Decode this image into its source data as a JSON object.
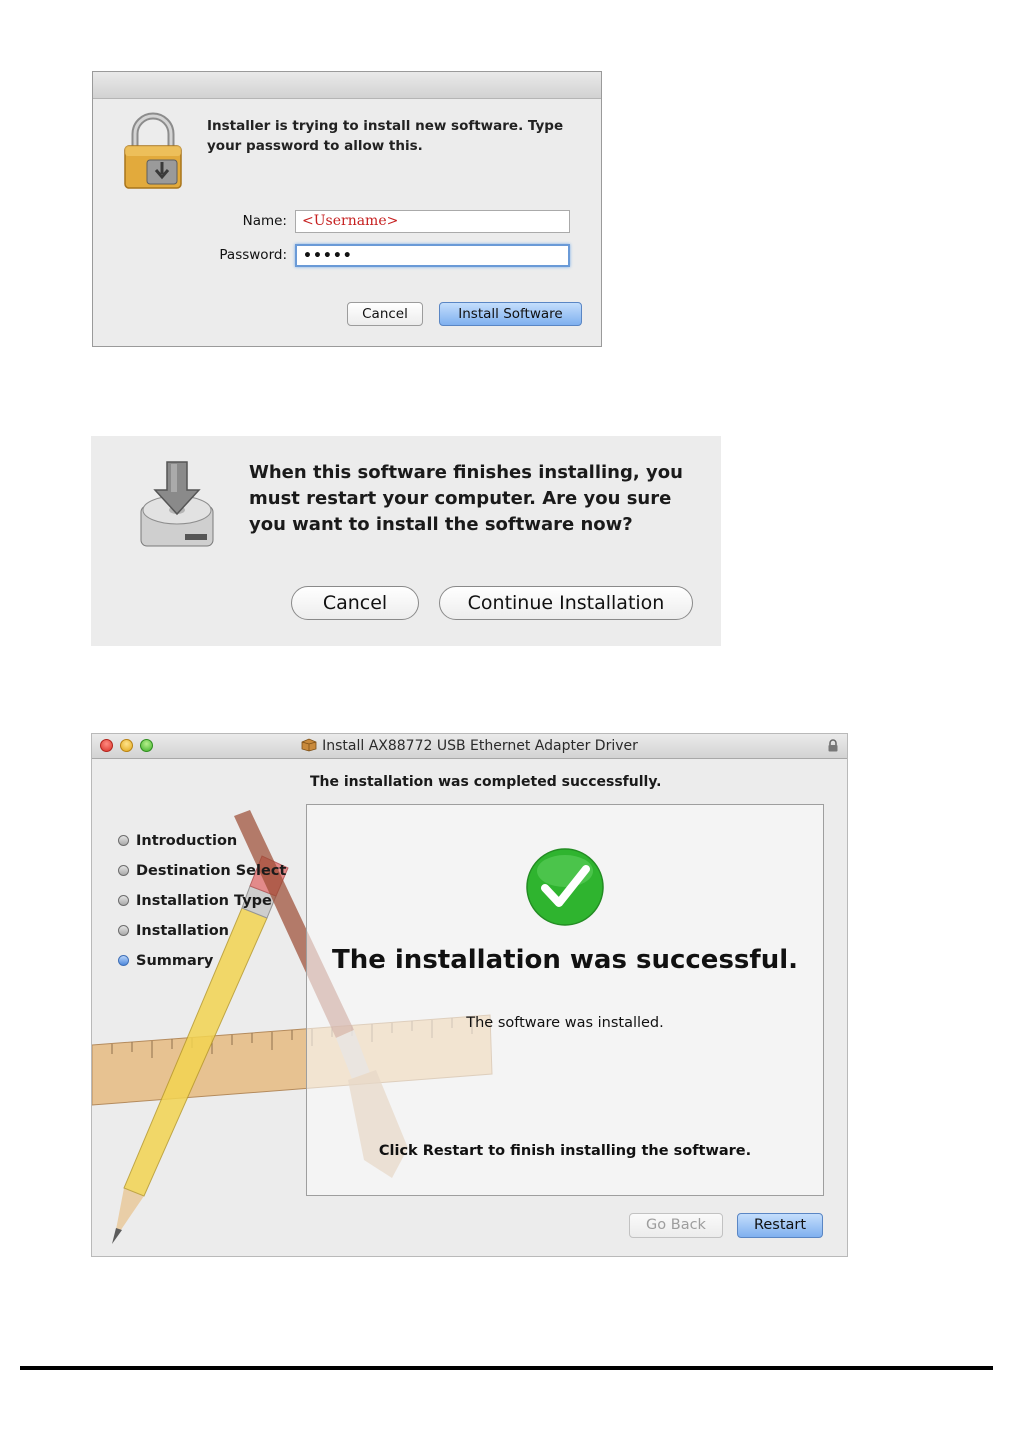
{
  "auth_dialog": {
    "message": "Installer is trying to install new software. Type your password to allow this.",
    "name_label": "Name:",
    "name_value": "<Username>",
    "password_label": "Password:",
    "password_value": "•••••",
    "cancel_label": "Cancel",
    "install_label": "Install Software"
  },
  "confirm_dialog": {
    "message": "When this software finishes installing, you must restart your computer. Are you sure you want to install the software now?",
    "cancel_label": "Cancel",
    "continue_label": "Continue Installation"
  },
  "installer_window": {
    "title": "Install AX88772 USB Ethernet Adapter Driver",
    "header": "The installation was completed successfully.",
    "steps": [
      {
        "label": "Introduction",
        "active": false
      },
      {
        "label": "Destination Select",
        "active": false
      },
      {
        "label": "Installation Type",
        "active": false
      },
      {
        "label": "Installation",
        "active": false
      },
      {
        "label": "Summary",
        "active": true
      }
    ],
    "success_title": "The installation was successful.",
    "success_subtitle": "The software was installed.",
    "restart_hint": "Click Restart to finish installing the software.",
    "go_back_label": "Go Back",
    "restart_label": "Restart",
    "colors": {
      "check_green": "#2fb42f",
      "button_blue": "#7fb0ef"
    }
  }
}
